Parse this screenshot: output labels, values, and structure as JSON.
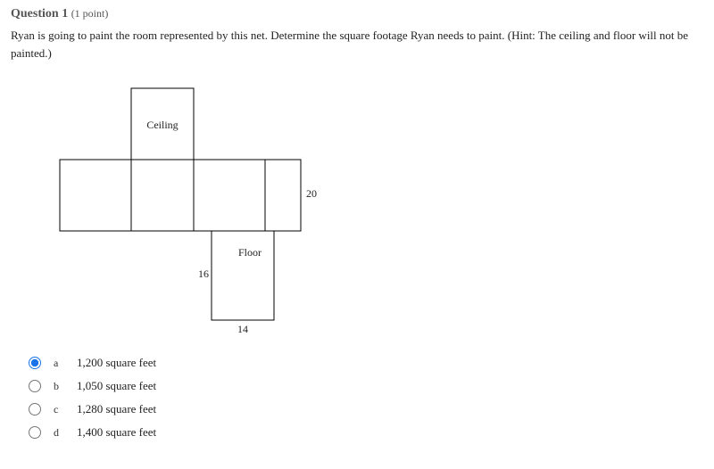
{
  "question": {
    "label": "Question",
    "number": "1",
    "points": "(1 point)",
    "text": "Ryan is going to paint the room represented by this net. Determine the square footage Ryan needs to paint. (Hint: The ceiling and floor will not be painted.)"
  },
  "diagram": {
    "ceiling_label": "Ceiling",
    "floor_label": "Floor",
    "dim_right": "20",
    "dim_left": "16",
    "dim_bottom": "14"
  },
  "options": {
    "name": "q1",
    "selected": "a",
    "items": [
      {
        "letter": "a",
        "text": "1,200 square feet"
      },
      {
        "letter": "b",
        "text": "1,050 square feet"
      },
      {
        "letter": "c",
        "text": "1,280 square feet"
      },
      {
        "letter": "d",
        "text": "1,400 square feet"
      }
    ]
  }
}
